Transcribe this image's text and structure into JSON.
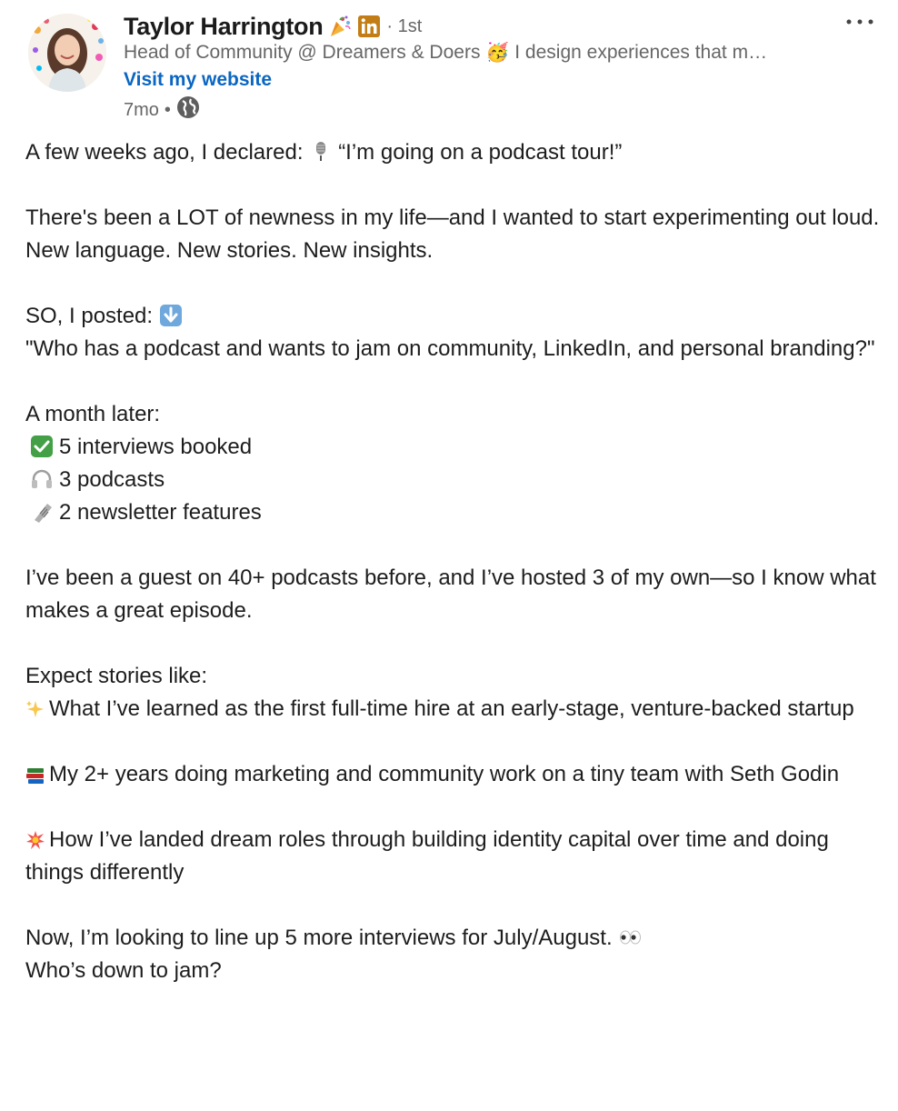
{
  "author": {
    "name": "Taylor Harrington",
    "degree": "1st",
    "headline": "Head of Community @ Dreamers & Doers 🥳 I design experiences that m…",
    "website_link": "Visit my website",
    "time_ago": "7mo",
    "visibility_icon": "globe-icon",
    "badges": [
      "party-popper-icon",
      "linkedin-icon"
    ]
  },
  "post": {
    "p1": "A few weeks ago, I declared:",
    "p1b": "“I’m going on a podcast tour!”",
    "p2": "There's been a LOT of newness in my life—and I wanted to start experimenting out loud. New language. New stories. New insights.",
    "p3a": "SO, I posted:",
    "p3b": "\"Who has a podcast and wants to jam on community, LinkedIn, and personal branding?\"",
    "p4": "A month later:",
    "list": [
      {
        "icon": "check-mark-icon",
        "text": "5 interviews booked"
      },
      {
        "icon": "headphones-icon",
        "text": "3 podcasts"
      },
      {
        "icon": "newspaper-icon",
        "text": "2 newsletter features"
      }
    ],
    "p5": "I’ve been a guest on 40+ podcasts before, and I’ve hosted 3 of my own—so I know what makes a great episode.",
    "p6": "Expect stories like:",
    "story1": "What I’ve learned as the first full-time hire at an early-stage, venture-backed startup",
    "story2": "My 2+ years doing marketing and community work on a tiny team with Seth Godin",
    "story3": "How I’ve landed dream roles through building identity capital over time and doing things differently",
    "p7a": "Now, I’m looking to line up 5 more interviews for July/August.",
    "p7b": "Who’s down to jam?"
  },
  "colors": {
    "link": "#0a66c2",
    "secondary_text": "#666666",
    "primary_text": "#1d1d1d",
    "linkedin_badge": "#c37d16"
  }
}
